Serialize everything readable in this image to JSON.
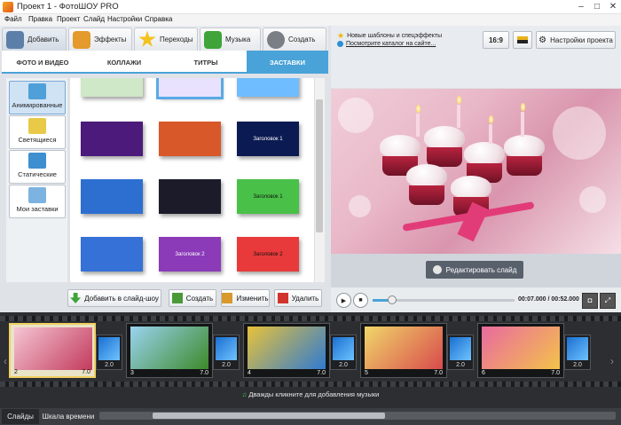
{
  "window": {
    "title": "Проект 1 - ФотоШОУ PRO",
    "controls": [
      "–",
      "□",
      "✕"
    ]
  },
  "menu": [
    "Файл",
    "Правка",
    "Проект",
    "Слайд",
    "Настройки",
    "Справка"
  ],
  "main_tabs": [
    {
      "label": "Добавить",
      "icon": "camera-icon",
      "color": "#5b7fa8"
    },
    {
      "label": "Эффекты",
      "icon": "palette-icon",
      "color": "#e49a2c"
    },
    {
      "label": "Переходы",
      "icon": "star-icon",
      "color": "#f2c21e"
    },
    {
      "label": "Музыка",
      "icon": "music-note-icon",
      "color": "#3fa43a"
    },
    {
      "label": "Создать",
      "icon": "film-reel-icon",
      "color": "#7a7f85"
    }
  ],
  "sub_tabs": [
    "ФОТО И ВИДЕО",
    "КОЛЛАЖИ",
    "ТИТРЫ",
    "ЗАСТАВКИ"
  ],
  "categories": [
    {
      "label": "Анимированные",
      "icon": "animated-icon"
    },
    {
      "label": "Светящиеся",
      "icon": "glow-icon"
    },
    {
      "label": "Статические",
      "icon": "static-icon"
    },
    {
      "label": "Мои заставки",
      "icon": "my-intro-icon"
    }
  ],
  "templates": [
    {
      "label": ""
    },
    {
      "label": ""
    },
    {
      "label": ""
    },
    {
      "label": ""
    },
    {
      "label": ""
    },
    {
      "label": "Заголовок 1"
    },
    {
      "label": ""
    },
    {
      "label": ""
    },
    {
      "label": "Заголовок 1"
    },
    {
      "label": ""
    },
    {
      "label": "Заголовок 2"
    },
    {
      "label": "Заголовок 2"
    }
  ],
  "template_colors": [
    "#cfe8c8",
    "#e8e2ff",
    "#6fbcff",
    "#4b1a7a",
    "#d8582a",
    "#0b1a52",
    "#2d6fd0",
    "#1b1b2a",
    "#49c048",
    "#3571d6",
    "#8b3ab8",
    "#e83a3a"
  ],
  "left_actions": [
    "Добавить в слайд-шоу",
    "Создать",
    "Изменить",
    "Удалить"
  ],
  "info_links": [
    "Новые шаблоны и спецэффекты",
    "Посмотрите каталог на сайте..."
  ],
  "aspect_label": "16:9",
  "settings_label": "Настройки проекта",
  "edit_slide_label": "Редактировать слайд",
  "player": {
    "time": "00:07.000 / 00:52.000",
    "progress": 0.13
  },
  "slides": [
    {
      "num": "2",
      "duration": "7.0",
      "colors": [
        "#f5c5d3",
        "#c23a5c"
      ]
    },
    {
      "num": "3",
      "duration": "7.0",
      "colors": [
        "#9ad3f0",
        "#3c8a2a"
      ]
    },
    {
      "num": "4",
      "duration": "7.0",
      "colors": [
        "#e8c23a",
        "#2f7bd1"
      ]
    },
    {
      "num": "5",
      "duration": "7.0",
      "colors": [
        "#f0d66a",
        "#d94b4b"
      ]
    },
    {
      "num": "6",
      "duration": "7.0",
      "colors": [
        "#e96aa0",
        "#f4c24a"
      ]
    }
  ],
  "transitions": [
    {
      "duration": "2.0"
    },
    {
      "duration": "2.0"
    },
    {
      "duration": "2.0"
    },
    {
      "duration": "2.0"
    },
    {
      "duration": "2.0"
    }
  ],
  "music_hint": "Дважды кликните для добавления музыки",
  "bottom_tabs": [
    "Слайды",
    "Шкала времени"
  ]
}
